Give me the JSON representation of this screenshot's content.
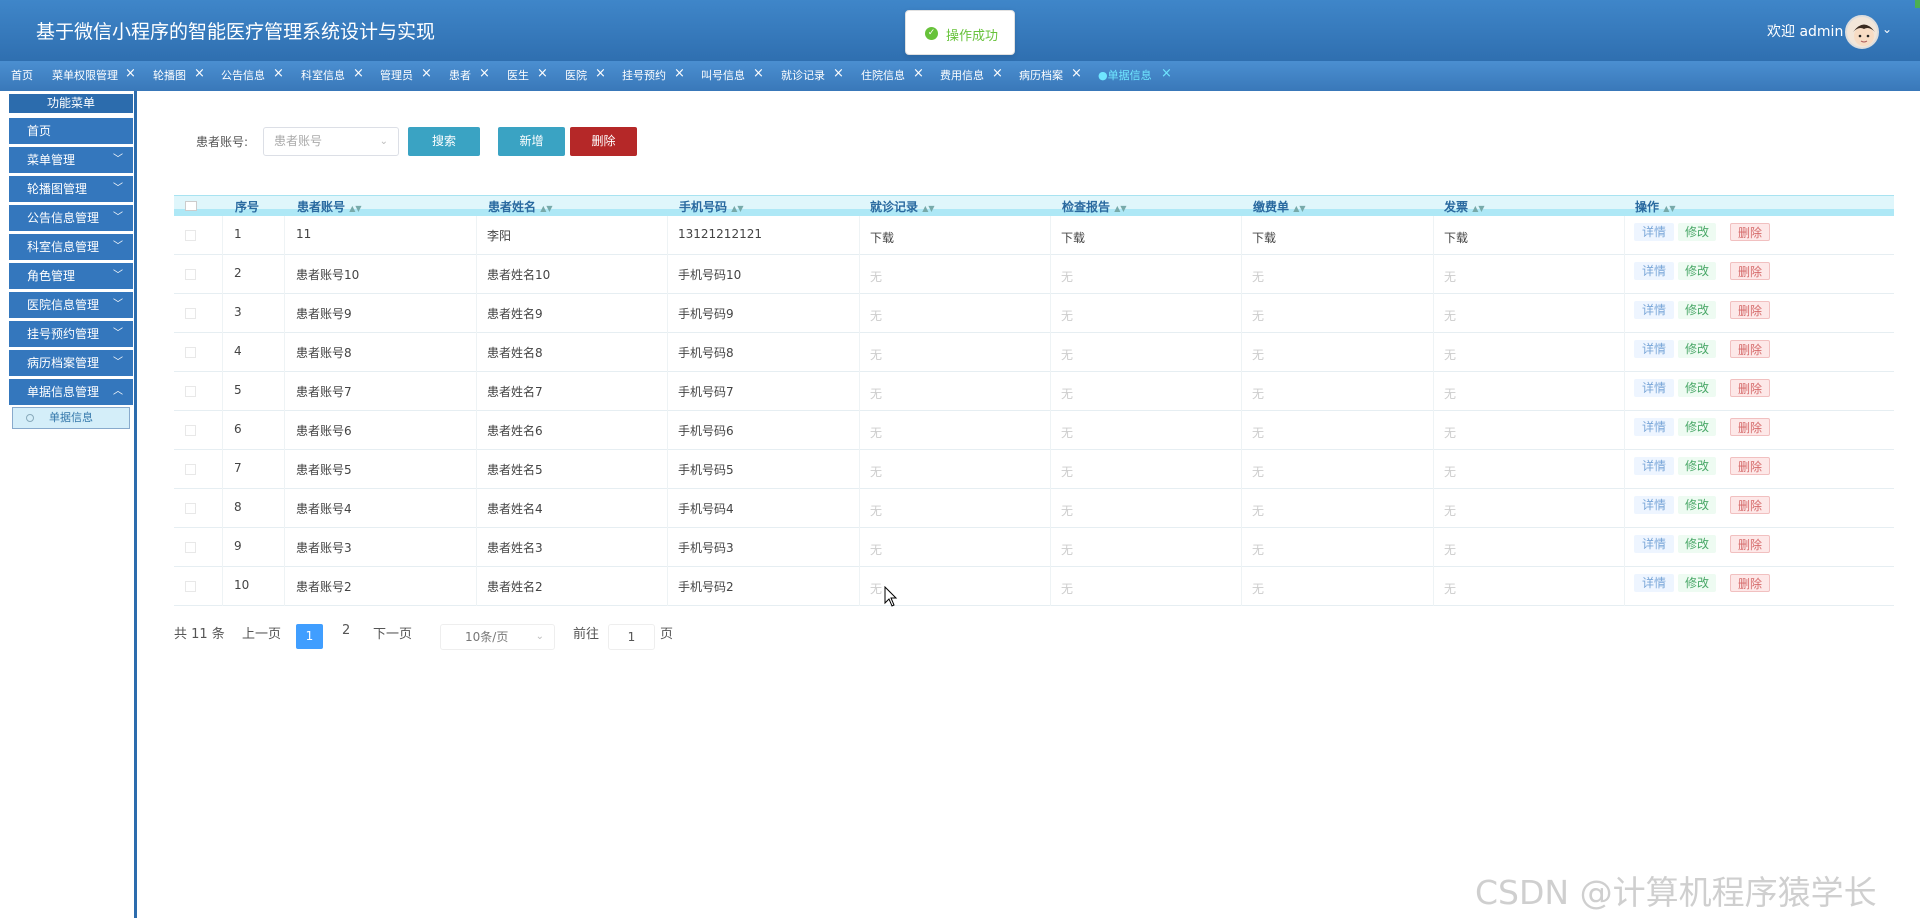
{
  "header": {
    "title": "基于微信小程序的智能医疗管理系统设计与实现",
    "welcome": "欢迎 admin",
    "toast": "操作成功",
    "colors": {
      "header_bg": "#3478bd",
      "toast_text": "#67c23a"
    }
  },
  "tabs": [
    {
      "label": "首页",
      "closable": false
    },
    {
      "label": "菜单权限管理",
      "closable": true
    },
    {
      "label": "轮播图",
      "closable": true
    },
    {
      "label": "公告信息",
      "closable": true
    },
    {
      "label": "科室信息",
      "closable": true
    },
    {
      "label": "管理员",
      "closable": true
    },
    {
      "label": "患者",
      "closable": true
    },
    {
      "label": "医生",
      "closable": true
    },
    {
      "label": "医院",
      "closable": true
    },
    {
      "label": "挂号预约",
      "closable": true
    },
    {
      "label": "叫号信息",
      "closable": true
    },
    {
      "label": "就诊记录",
      "closable": true
    },
    {
      "label": "住院信息",
      "closable": true
    },
    {
      "label": "费用信息",
      "closable": true
    },
    {
      "label": "病历档案",
      "closable": true
    },
    {
      "label": "●单据信息",
      "closable": true,
      "active": true
    }
  ],
  "sidebar": {
    "title": "功能菜单",
    "items": [
      {
        "label": "首页",
        "expandable": false
      },
      {
        "label": "菜单管理",
        "expandable": true
      },
      {
        "label": "轮播图管理",
        "expandable": true
      },
      {
        "label": "公告信息管理",
        "expandable": true
      },
      {
        "label": "科室信息管理",
        "expandable": true
      },
      {
        "label": "角色管理",
        "expandable": true
      },
      {
        "label": "医院信息管理",
        "expandable": true
      },
      {
        "label": "挂号预约管理",
        "expandable": true
      },
      {
        "label": "病历档案管理",
        "expandable": true
      },
      {
        "label": "单据信息管理",
        "expandable": true,
        "expanded": true
      }
    ],
    "sub_item": "单据信息"
  },
  "search": {
    "label": "患者账号:",
    "placeholder": "患者账号",
    "search_btn": "搜索",
    "add_btn": "新增",
    "delete_btn": "删除"
  },
  "table": {
    "headers": [
      "序号",
      "患者账号",
      "患者姓名",
      "手机号码",
      "就诊记录",
      "检查报告",
      "缴费单",
      "发票",
      "操作"
    ],
    "rows": [
      [
        "1",
        "11",
        "李阳",
        "13121212121",
        "下载",
        "下载",
        "下载",
        "下载"
      ],
      [
        "2",
        "患者账号10",
        "患者姓名10",
        "手机号码10",
        "无",
        "无",
        "无",
        "无"
      ],
      [
        "3",
        "患者账号9",
        "患者姓名9",
        "手机号码9",
        "无",
        "无",
        "无",
        "无"
      ],
      [
        "4",
        "患者账号8",
        "患者姓名8",
        "手机号码8",
        "无",
        "无",
        "无",
        "无"
      ],
      [
        "5",
        "患者账号7",
        "患者姓名7",
        "手机号码7",
        "无",
        "无",
        "无",
        "无"
      ],
      [
        "6",
        "患者账号6",
        "患者姓名6",
        "手机号码6",
        "无",
        "无",
        "无",
        "无"
      ],
      [
        "7",
        "患者账号5",
        "患者姓名5",
        "手机号码5",
        "无",
        "无",
        "无",
        "无"
      ],
      [
        "8",
        "患者账号4",
        "患者姓名4",
        "手机号码4",
        "无",
        "无",
        "无",
        "无"
      ],
      [
        "9",
        "患者账号3",
        "患者姓名3",
        "手机号码3",
        "无",
        "无",
        "无",
        "无"
      ],
      [
        "10",
        "患者账号2",
        "患者姓名2",
        "手机号码2",
        "无",
        "无",
        "无",
        "无"
      ]
    ],
    "row_actions": {
      "detail": "详情",
      "edit": "修改",
      "delete": "删除"
    }
  },
  "pagination": {
    "total": "共 11 条",
    "prev": "上一页",
    "current": "1",
    "other_page": "2",
    "next": "下一页",
    "page_size": "10条/页",
    "goto_label": "前往",
    "goto_value": "1",
    "goto_suffix": "页"
  },
  "watermark": "CSDN @计算机程序猿学长"
}
